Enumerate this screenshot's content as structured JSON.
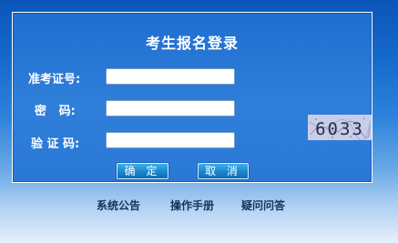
{
  "panel": {
    "title": "考生报名登录"
  },
  "form": {
    "exam_id_label": "准考证号:",
    "password_label": "密   码:",
    "captcha_label": "验 证 码:",
    "exam_id_value": "",
    "password_value": "",
    "captcha_value": ""
  },
  "captcha": {
    "code": "6033"
  },
  "buttons": {
    "confirm_label": "确 定",
    "cancel_label": "取 消"
  },
  "footer": {
    "links": [
      "系统公告",
      "操作手册",
      "疑问问答"
    ]
  },
  "colors": {
    "panel_border": "#ffffff",
    "button_bg": "#1a86cf",
    "footer_link": "#16345e"
  }
}
